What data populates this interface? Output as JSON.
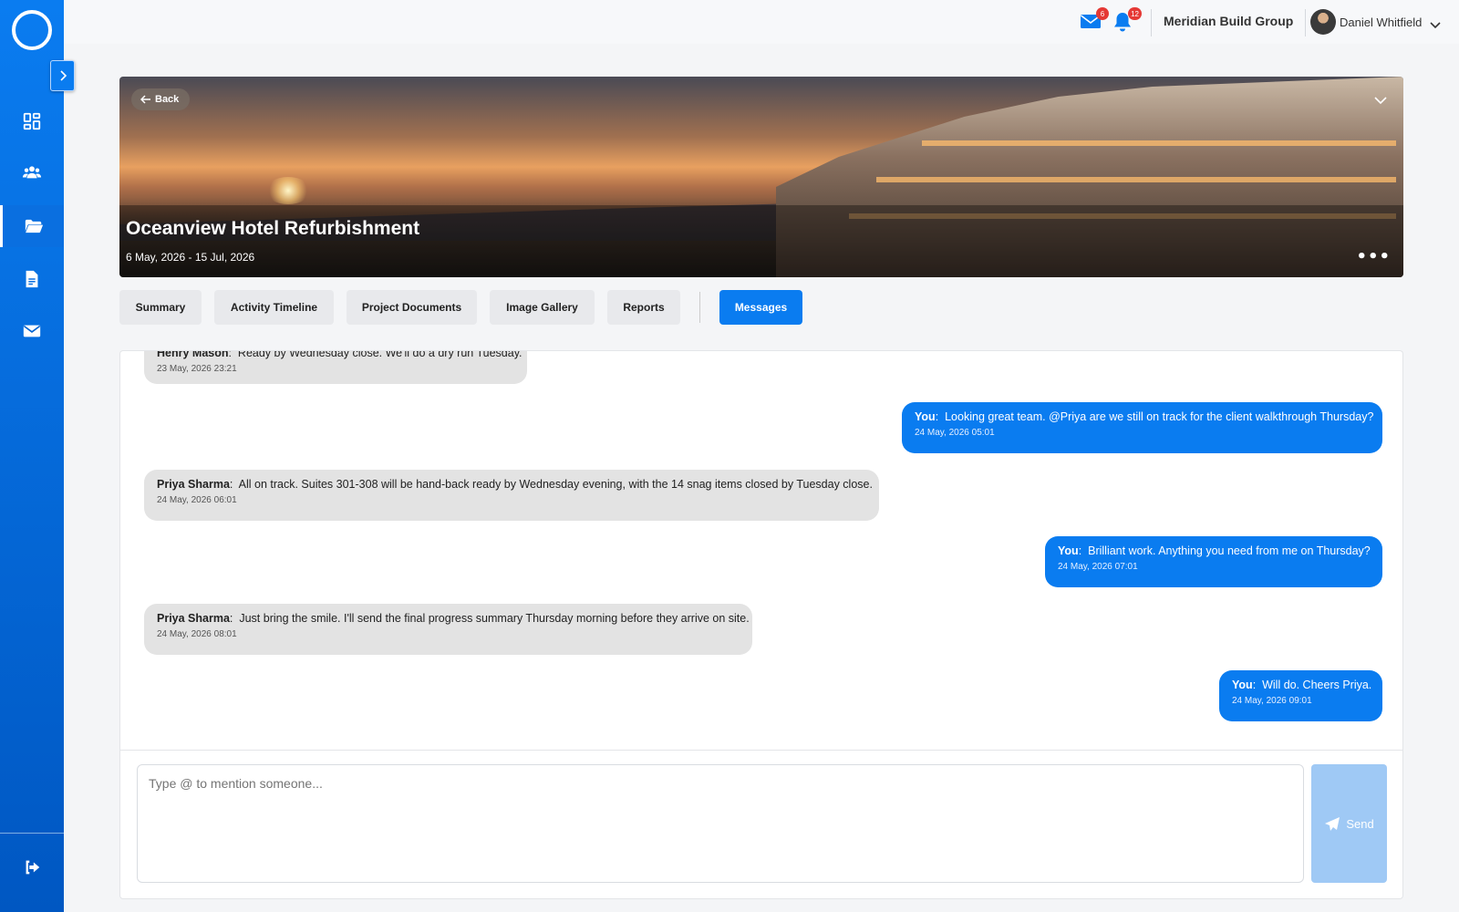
{
  "topbar": {
    "mail_badge": "6",
    "notif_badge": "12",
    "company": "Meridian Build Group",
    "user_name": "Daniel Whitfield"
  },
  "sidebar": {
    "items": [
      {
        "icon": "dashboard-icon"
      },
      {
        "icon": "users-icon"
      },
      {
        "icon": "folder-open-icon",
        "active": true
      },
      {
        "icon": "document-icon"
      },
      {
        "icon": "envelope-icon"
      }
    ],
    "logout_icon": "logout-icon"
  },
  "hero": {
    "back_label": "Back",
    "title": "Oceanview Hotel Refurbishment",
    "dates": "6 May, 2026 - 15 Jul, 2026",
    "more": "•••"
  },
  "tabs": [
    {
      "label": "Summary"
    },
    {
      "label": "Activity Timeline"
    },
    {
      "label": "Project Documents"
    },
    {
      "label": "Image Gallery"
    },
    {
      "label": "Reports"
    },
    {
      "label": "Messages",
      "active": true
    }
  ],
  "messages": [
    {
      "direction": "in",
      "sender": "Henry Mason",
      "text": "Ready by Wednesday close. We'll do a dry run Tuesday.",
      "time": "23 May, 2026 23:21"
    },
    {
      "direction": "out",
      "sender": "You",
      "text": "Looking great team. @Priya are we still on track for the client walkthrough Thursday?",
      "time": "24 May, 2026 05:01"
    },
    {
      "direction": "in",
      "sender": "Priya Sharma",
      "text": "All on track. Suites 301-308 will be hand-back ready by Wednesday evening, with the 14 snag items closed by Tuesday close.",
      "time": "24 May, 2026 06:01"
    },
    {
      "direction": "out",
      "sender": "You",
      "text": "Brilliant work. Anything you need from me on Thursday?",
      "time": "24 May, 2026 07:01"
    },
    {
      "direction": "in",
      "sender": "Priya Sharma",
      "text": "Just bring the smile. I'll send the final progress summary Thursday morning before they arrive on site.",
      "time": "24 May, 2026 08:01"
    },
    {
      "direction": "out",
      "sender": "You",
      "text": "Will do. Cheers Priya.",
      "time": "24 May, 2026 09:01"
    }
  ],
  "composer": {
    "placeholder": "Type @ to mention someone...",
    "send_label": "Send"
  },
  "colors": {
    "accent": "#0a7cf0",
    "incoming_bubble": "#e3e3e3",
    "send_disabled": "#9fc9f5",
    "badge": "#e53935"
  }
}
